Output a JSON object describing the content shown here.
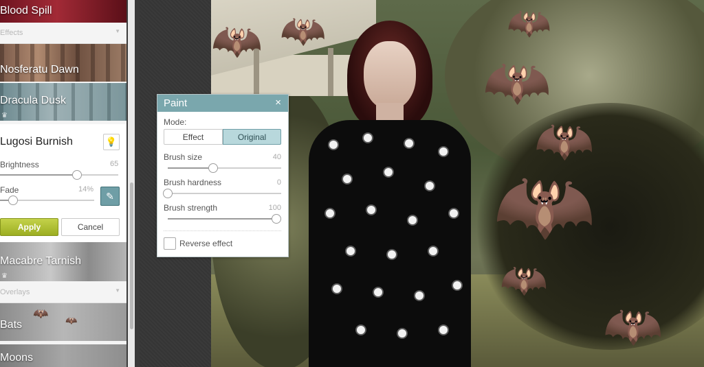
{
  "effects_panel": {
    "top_effect": "Blood Spill",
    "section_effects": "Effects",
    "effects": [
      {
        "label": "Nosferatu Dawn"
      },
      {
        "label": "Dracula Dusk",
        "premium": true
      }
    ],
    "active_effect": {
      "title": "Lugosi Burnish",
      "brightness": {
        "label": "Brightness",
        "value": "65",
        "level": 65
      },
      "fade": {
        "label": "Fade",
        "value": "14%",
        "level": 14
      },
      "apply_label": "Apply",
      "cancel_label": "Cancel"
    },
    "after_effects": [
      {
        "label": "Macabre Tarnish",
        "premium": true
      }
    ],
    "section_overlays": "Overlays",
    "overlays": [
      {
        "label": "Bats"
      },
      {
        "label": "Moons"
      }
    ]
  },
  "paint_dialog": {
    "title": "Paint",
    "close_glyph": "×",
    "mode_label": "Mode:",
    "mode_options": [
      "Effect",
      "Original"
    ],
    "mode_selected": "Original",
    "brush_size": {
      "label": "Brush size",
      "value": "40",
      "level": 40
    },
    "brush_hardness": {
      "label": "Brush hardness",
      "value": "0",
      "level": 0
    },
    "brush_strength": {
      "label": "Brush strength",
      "value": "100",
      "level": 100
    },
    "reverse_effect": {
      "label": "Reverse effect",
      "checked": false
    }
  },
  "icons": {
    "crown": "♛",
    "bulb": "💡",
    "brush": "✎",
    "chevron": "▼",
    "bat": "🦇"
  },
  "colors": {
    "accent_teal": "#7aa7ad",
    "apply_green": "#a8b82c"
  }
}
